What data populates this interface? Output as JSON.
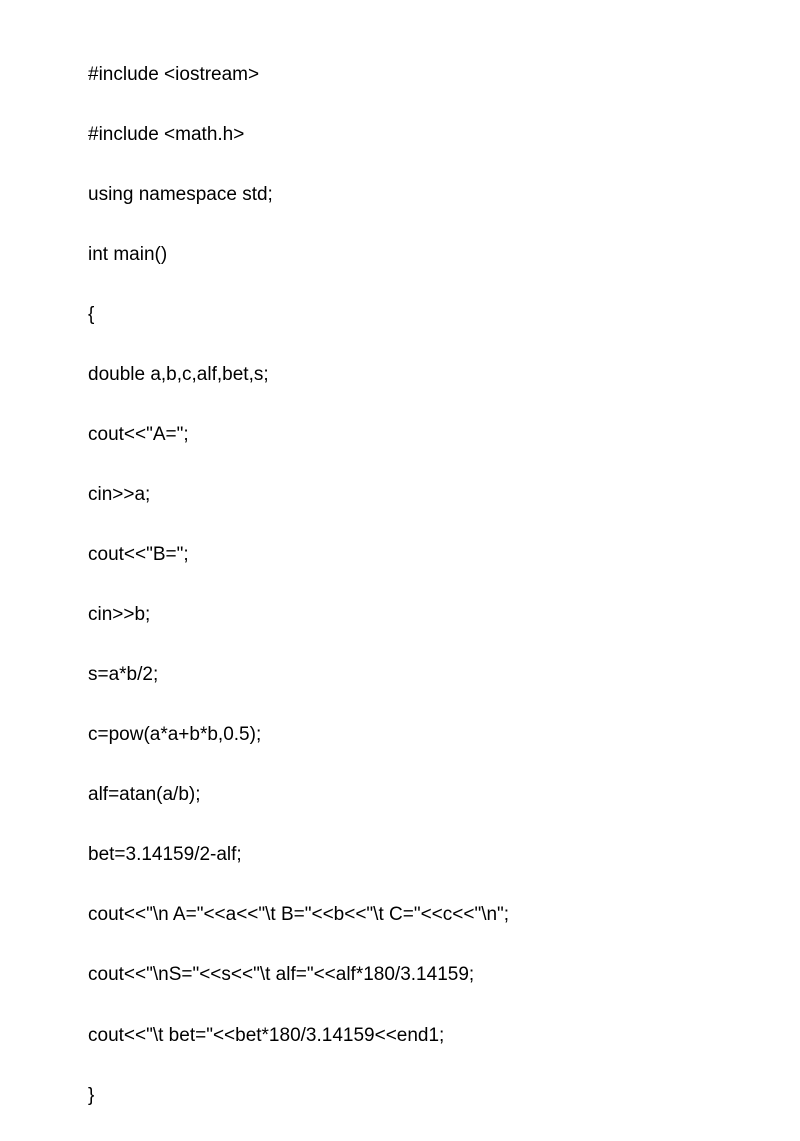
{
  "code": {
    "lines": [
      "#include <iostream>",
      "#include <math.h>",
      "using namespace std;",
      "int main()",
      "{",
      "double a,b,c,alf,bet,s;",
      "cout<<\"A=\";",
      "cin>>a;",
      "cout<<\"B=\";",
      "cin>>b;",
      "s=a*b/2;",
      "c=pow(a*a+b*b,0.5);",
      "alf=atan(a/b);",
      "bet=3.14159/2-alf;",
      "cout<<\"\\n A=\"<<a<<\"\\t B=\"<<b<<\"\\t C=\"<<c<<\"\\n\";",
      "cout<<\"\\nS=\"<<s<<\"\\t alf=\"<<alf*180/3.14159;",
      "cout<<\"\\t bet=\"<<bet*180/3.14159<<end1;",
      "}"
    ]
  }
}
